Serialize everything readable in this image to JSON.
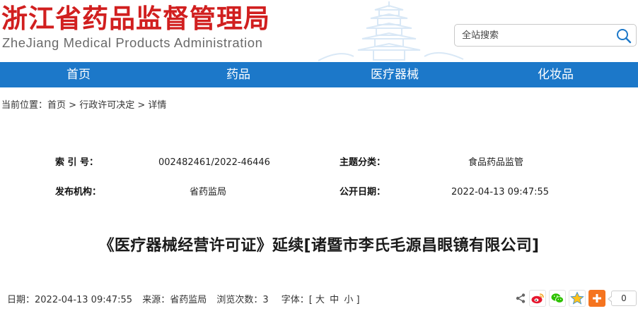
{
  "header": {
    "logo_cn": "浙江省药品监督管理局",
    "logo_en": "ZheJiang Medical Products Administration"
  },
  "search": {
    "placeholder": "全站搜索"
  },
  "nav": {
    "items": [
      "首页",
      "药品",
      "医疗器械",
      "化妆品"
    ]
  },
  "breadcrumb": {
    "prefix": "当前位置：",
    "items": [
      "首页",
      "行政许可决定",
      "详情"
    ],
    "separator": ">"
  },
  "info": {
    "index_label": "索 引 号：",
    "index_value": "002482461/2022-46446",
    "category_label": "主题分类：",
    "category_value": "食品药品监管",
    "publisher_label": "发布机构：",
    "publisher_value": "省药监局",
    "date_label": "公开日期：",
    "date_value": "2022-04-13 09:47:55"
  },
  "article": {
    "title": "《医疗器械经营许可证》延续[诸暨市李氏毛源昌眼镜有限公司]"
  },
  "meta": {
    "date": "日期：2022-04-13 09:47:55",
    "source": "来源：省药监局",
    "views": "浏览次数：3",
    "font_label": "字体：[",
    "font_large": "大",
    "font_medium": "中",
    "font_small": "小",
    "font_close": "]"
  },
  "share": {
    "icons": [
      "share-icon",
      "weibo-icon",
      "wechat-icon",
      "qzone-icon",
      "more-share-icon"
    ],
    "count": "0"
  },
  "colors": {
    "brand_red": "#d11f1f",
    "nav_blue": "#1c78c9"
  }
}
